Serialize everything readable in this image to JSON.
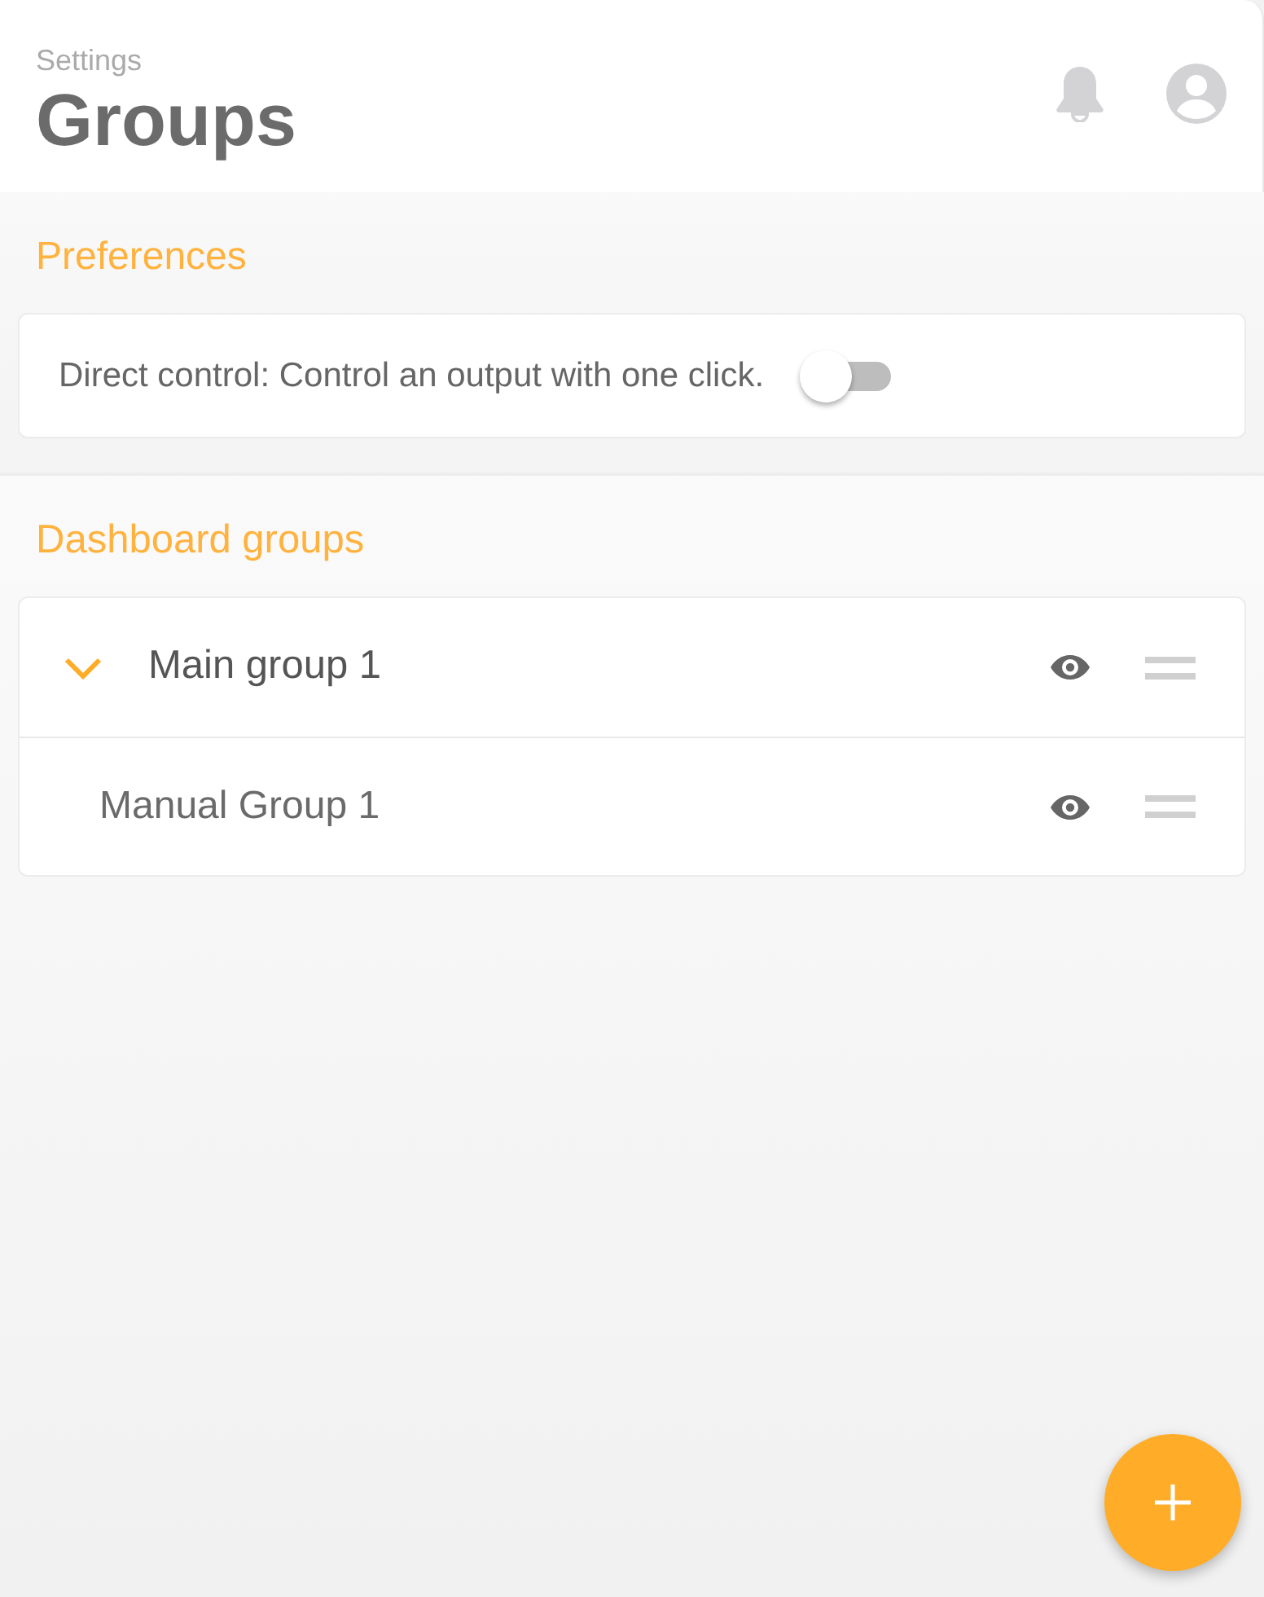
{
  "header": {
    "breadcrumb": "Settings",
    "title": "Groups"
  },
  "preferences": {
    "heading": "Preferences",
    "direct_control": {
      "label": "Direct control: Control an output with one click.",
      "on": false
    }
  },
  "dashboard_groups": {
    "heading": "Dashboard groups",
    "groups": [
      {
        "name": "Main group 1",
        "expanded": true,
        "children": [
          {
            "name": "Manual Group 1"
          }
        ]
      }
    ]
  }
}
